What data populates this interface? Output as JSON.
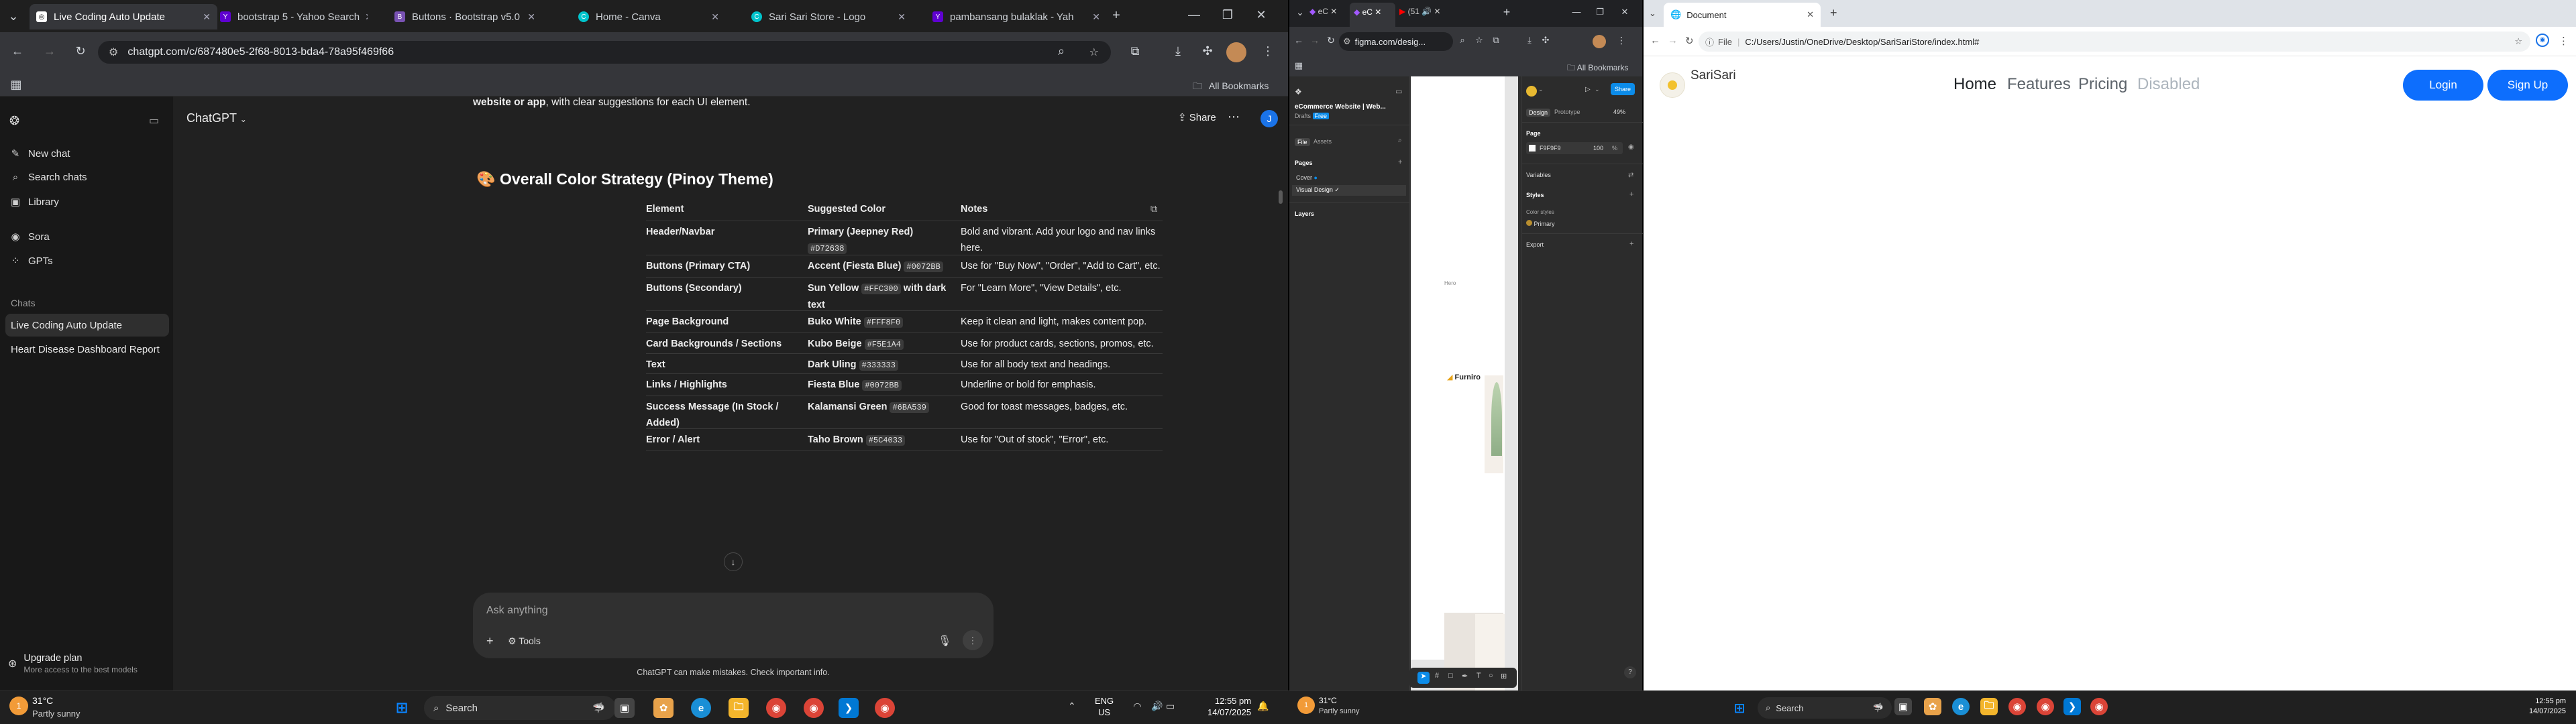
{
  "win1": {
    "tabs": [
      {
        "title": "Live Coding Auto Update",
        "active": true
      },
      {
        "title": "bootstrap 5 - Yahoo Search"
      },
      {
        "title": "Buttons · Bootstrap v5.0"
      },
      {
        "title": "Home - Canva"
      },
      {
        "title": "Sari Sari Store - Logo"
      },
      {
        "title": "pambansang bulaklak - Yah"
      }
    ],
    "url": "chatgpt.com/c/687480e5-2f68-8013-bda4-78a95f469f66",
    "bookmarks_label": "All Bookmarks",
    "sidebar": {
      "items": [
        {
          "label": "New chat",
          "icon": "pencil-icon"
        },
        {
          "label": "Search chats",
          "icon": "search-icon"
        },
        {
          "label": "Library",
          "icon": "library-icon"
        },
        {
          "label": "Sora",
          "icon": "sora-icon"
        },
        {
          "label": "GPTs",
          "icon": "grid-icon"
        }
      ],
      "chats_heading": "Chats",
      "chats": [
        "Live Coding Auto Update",
        "Heart Disease Dashboard Report"
      ],
      "upgrade_title": "Upgrade plan",
      "upgrade_sub": "More access to the best models"
    },
    "header": {
      "model": "ChatGPT",
      "share": "Share"
    },
    "intro_tail_bold": "website or app",
    "intro_tail_rest": ", with clear suggestions for each UI element.",
    "section_emoji": "🎨",
    "section_title": "Overall Color Strategy (Pinoy Theme)",
    "table": {
      "headers": [
        "Element",
        "Suggested Color",
        "Notes"
      ],
      "rows": [
        {
          "element": "Header/Navbar",
          "color_name": "Primary (Jeepney Red)",
          "hex": "#D72638",
          "notes": "Bold and vibrant. Add your logo and nav links here."
        },
        {
          "element": "Buttons (Primary CTA)",
          "color_name": "Accent (Fiesta Blue)",
          "hex": "#0072BB",
          "notes": "Use for \"Buy Now\", \"Order\", \"Add to Cart\", etc."
        },
        {
          "element": "Buttons (Secondary)",
          "color_name": "Sun Yellow",
          "hex": "#FFC300",
          "color_suffix": "with dark text",
          "notes": "For \"Learn More\", \"View Details\", etc."
        },
        {
          "element": "Page Background",
          "color_name": "Buko White",
          "hex": "#FFF8F0",
          "notes": "Keep it clean and light, makes content pop."
        },
        {
          "element": "Card Backgrounds / Sections",
          "color_name": "Kubo Beige",
          "hex": "#F5E1A4",
          "notes": "Use for product cards, sections, promos, etc."
        },
        {
          "element": "Text",
          "color_name": "Dark Uling",
          "hex": "#333333",
          "notes": "Use for all body text and headings."
        },
        {
          "element": "Links / Highlights",
          "color_name": "Fiesta Blue",
          "hex": "#0072BB",
          "notes": "Underline or bold for emphasis."
        },
        {
          "element": "Success Message (In Stock / Added)",
          "color_name": "Kalamansi Green",
          "hex": "#6BA539",
          "notes": "Good for toast messages, badges, etc."
        },
        {
          "element": "Error / Alert",
          "color_name": "Taho Brown",
          "hex": "#5C4033",
          "notes": "Use for \"Out of stock\", \"Error\", etc."
        }
      ]
    },
    "composer_placeholder": "Ask anything",
    "tools_label": "Tools",
    "disclaimer": "ChatGPT can make mistakes. Check important info."
  },
  "win2": {
    "tabs": [
      "eC",
      "eC",
      "(51"
    ],
    "url": "figma.com/desig...",
    "bookmarks_label": "All Bookmarks",
    "file_title": "eCommerce Website | Web...",
    "file_sub": "Drafts",
    "file_badge": "Free",
    "left_tabs": [
      "File",
      "Assets"
    ],
    "pages_label": "Pages",
    "pages": [
      "Cover",
      "Visual Design"
    ],
    "layers_label": "Layers",
    "right_tabs": [
      "Design",
      "Prototype"
    ],
    "zoom": "49%",
    "share_label": "Share",
    "page_section": "Page",
    "page_color": "F9F9F9",
    "page_opacity": "100",
    "variables_label": "Variables",
    "styles_label": "Styles",
    "color_styles_label": "Color styles",
    "style_primary": "Primary",
    "export_label": "Export",
    "canvas_label": "Hero",
    "canvas_logo": "Furniro",
    "help": "?"
  },
  "win3": {
    "tab_title": "Document",
    "url_prefix": "File",
    "url": "C:/Users/Justin/OneDrive/Desktop/SariSariStore/index.html#",
    "brand": "SariSari",
    "nav": [
      {
        "label": "Home",
        "state": "active"
      },
      {
        "label": "Features",
        "state": "normal"
      },
      {
        "label": "Pricing",
        "state": "normal"
      },
      {
        "label": "Disabled",
        "state": "disabled"
      }
    ],
    "login": "Login",
    "signup": "Sign Up",
    "accent": "#0d6efd"
  },
  "taskbar_left": {
    "weather_temp": "31°C",
    "weather_desc": "Partly sunny",
    "weather_badge": "1",
    "search": "Search",
    "lang1": "ENG",
    "lang2": "US",
    "time": "12:55 pm",
    "date": "14/07/2025"
  },
  "taskbar_right": {
    "weather_temp": "31°C",
    "weather_desc": "Partly sunny",
    "weather_badge": "1",
    "search": "Search",
    "time": "12:55 pm",
    "date": "14/07/2025"
  }
}
